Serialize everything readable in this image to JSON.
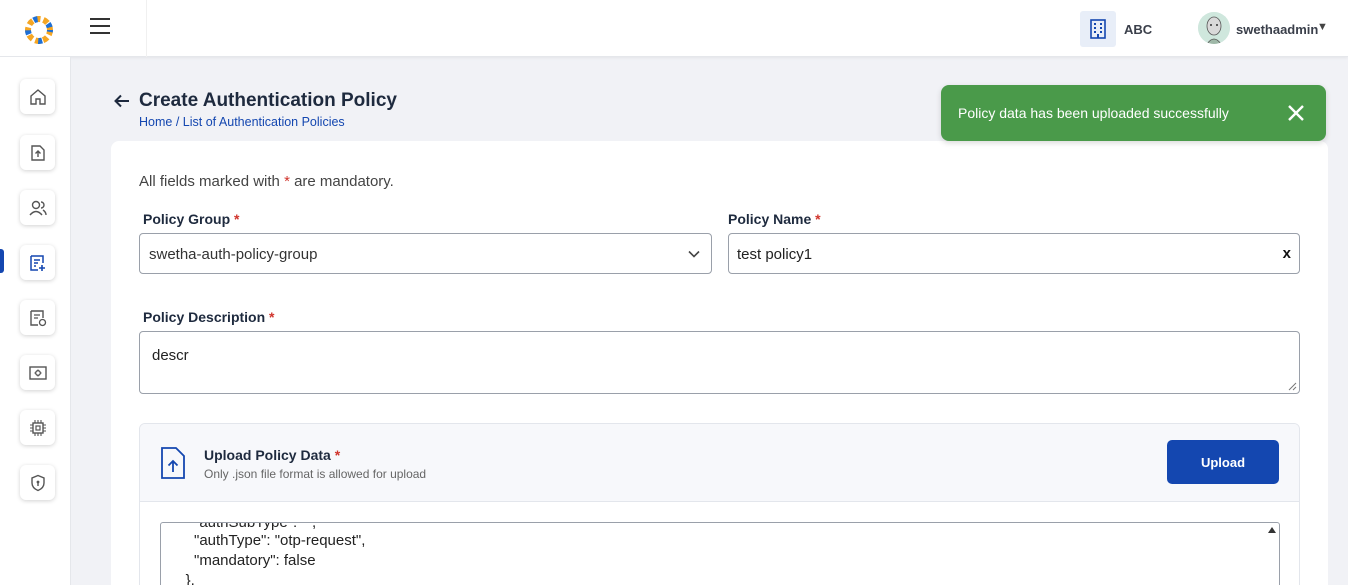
{
  "header": {
    "org_name": "ABC",
    "username": "swethaadmin",
    "user_caret": "▼"
  },
  "sidebar": {
    "items": [
      {
        "name": "home-icon"
      },
      {
        "name": "upload-icon"
      },
      {
        "name": "users-icon"
      },
      {
        "name": "policy-add-icon",
        "active": true
      },
      {
        "name": "policy-list-icon"
      },
      {
        "name": "settings-screen-icon"
      },
      {
        "name": "chip-icon"
      },
      {
        "name": "shield-icon"
      }
    ],
    "active_color": "#1447b0"
  },
  "page": {
    "title": "Create Authentication Policy",
    "breadcrumb_home": "Home",
    "breadcrumb_sep": " / ",
    "breadcrumb_current": "List of Authentication Policies"
  },
  "toast": {
    "message": "Policy data has been uploaded successfully",
    "color": "#4a9a4a"
  },
  "form": {
    "mandatory_prefix": "All fields marked with ",
    "mandatory_star": "*",
    "mandatory_suffix": " are mandatory.",
    "policy_group_label": "Policy Group",
    "policy_group_value": "swetha-auth-policy-group",
    "policy_name_label": "Policy Name",
    "policy_name_value": "test policy1",
    "clear_label": "x",
    "policy_description_label": "Policy Description",
    "policy_description_value": "descr",
    "required_star": "*"
  },
  "upload": {
    "title": "Upload Policy Data",
    "subtitle": "Only .json file format is allowed for upload",
    "button_label": "Upload",
    "button_color": "#1447b0",
    "code_lines": [
      "      \"authSubType\": \"\",",
      "      \"authType\": \"otp-request\",",
      "      \"mandatory\": false",
      "    },"
    ]
  }
}
